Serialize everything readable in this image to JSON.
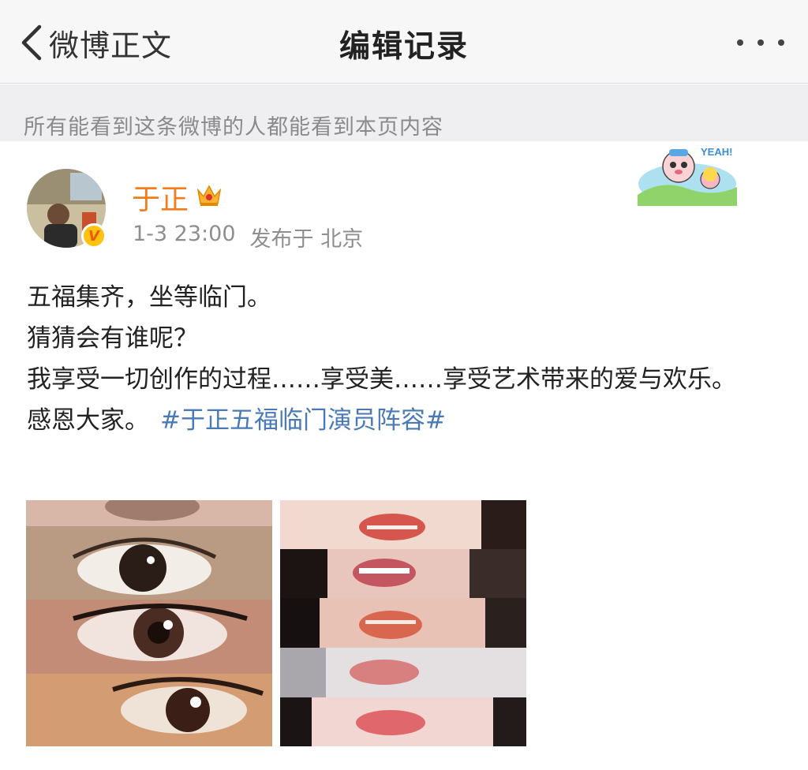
{
  "navbar": {
    "back_label": "微博正文",
    "title": "编辑记录",
    "more_icon": "more-dots-icon"
  },
  "visibility": {
    "text": "所有能看到这条微博的人都能看到本页内容"
  },
  "post": {
    "author": "于正",
    "verified_badge": "V",
    "crown_icon": "crown-icon",
    "time": "1-3 23:00",
    "source": "发布于 北京",
    "lines": [
      "五福集齐，坐等临门。",
      "猜猜会有谁呢？",
      "我享受一切创作的过程……享受美……享受艺术带来的爱与欢乐。"
    ],
    "last_line_text": "感恩大家。",
    "hashtag": "#于正五福临门演员阵容#",
    "sticker_text": "YEAH!",
    "images": [
      {
        "name": "eyes-collage",
        "icon": "image"
      },
      {
        "name": "lips-collage",
        "icon": "image"
      }
    ]
  },
  "colors": {
    "username": "#f27d1a",
    "hashtag": "#4a7ab5",
    "meta": "#8e8e8e",
    "nav_bg": "#f7f7f7",
    "notice_bg": "#efeff2"
  }
}
